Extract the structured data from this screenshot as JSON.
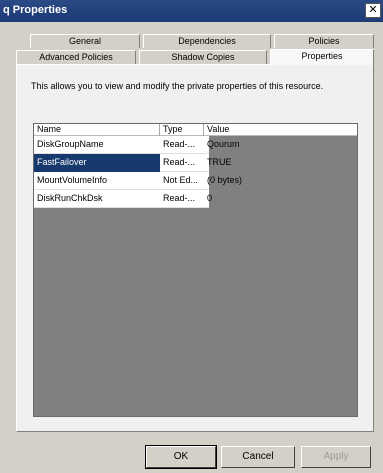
{
  "window": {
    "title": "q Properties",
    "close_glyph": "✕"
  },
  "tabs": {
    "row1": [
      {
        "label": "General"
      },
      {
        "label": "Dependencies"
      },
      {
        "label": "Policies"
      }
    ],
    "row2": [
      {
        "label": "Advanced Policies"
      },
      {
        "label": "Shadow Copies"
      },
      {
        "label": "Properties",
        "active": true
      }
    ]
  },
  "panel": {
    "description": "This allows you to view and modify the private properties of this resource."
  },
  "table": {
    "columns": [
      "Name",
      "Type",
      "Value"
    ],
    "rows": [
      {
        "name": "DiskGroupName",
        "type": "Read-...",
        "value": "Qourum"
      },
      {
        "name": "FastFailover",
        "type": "Read-...",
        "value": "TRUE",
        "selected": true
      },
      {
        "name": "MountVolumeInfo",
        "type": "Not Ed...",
        "value": "(0 bytes)"
      },
      {
        "name": "DiskRunChkDsk",
        "type": "Read-...",
        "value": "0"
      }
    ]
  },
  "buttons": {
    "ok": "OK",
    "cancel": "Cancel",
    "apply": "Apply"
  }
}
